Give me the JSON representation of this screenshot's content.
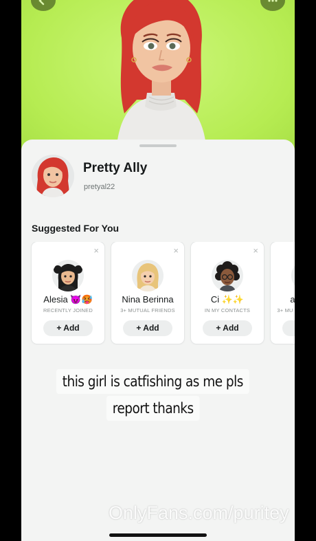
{
  "profile": {
    "display_name": "Pretty Ally",
    "username": "pretyal22"
  },
  "suggested": {
    "title": "Suggested For You",
    "close_glyph": "×",
    "cards": [
      {
        "name": "Alesia 😈🥵",
        "reason": "RECENTLY JOINED",
        "add_label": "+ Add",
        "avatar": "bitmoji-black-pigtails"
      },
      {
        "name": "Nina Berinna",
        "reason": "3+ MUTUAL FRIENDS",
        "add_label": "+ Add",
        "avatar": "bitmoji-blonde"
      },
      {
        "name": "Ci ✨✨",
        "reason": "IN MY CONTACTS",
        "add_label": "+ Add",
        "avatar": "bitmoji-curly-glasses"
      },
      {
        "name": "a",
        "reason": "3+ MU",
        "add_label": "+",
        "avatar": "bitmoji-partial"
      }
    ]
  },
  "caption": {
    "line1": "this girl is catfishing as me pls",
    "line2": "report thanks"
  },
  "watermark": "OnlyFans.com/puritey",
  "colors": {
    "hero_background": "#b6ec52",
    "sheet_background": "#f3f4f3",
    "card_background": "#ffffff",
    "add_button": "#eceeee"
  },
  "icons": [
    "back-arrow-icon",
    "more-options-icon",
    "close-icon"
  ]
}
